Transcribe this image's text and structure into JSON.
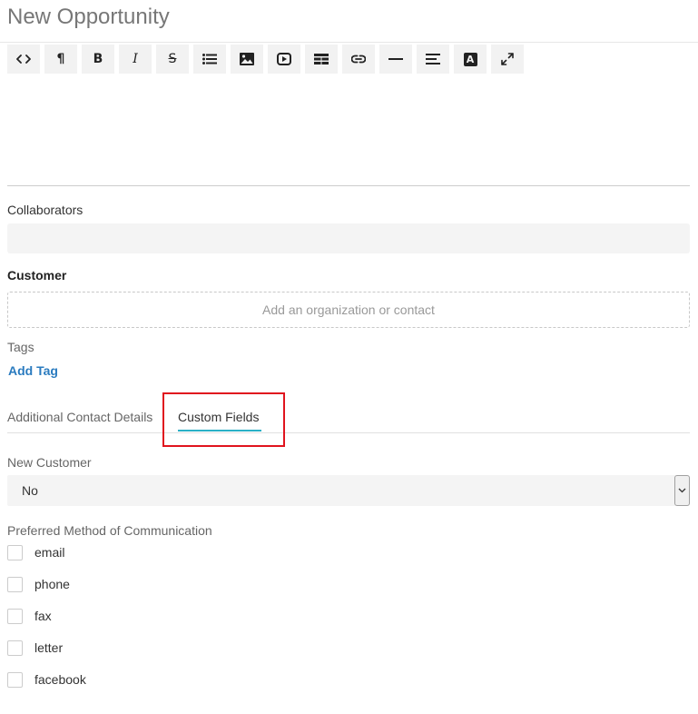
{
  "header": {
    "title": "New Opportunity"
  },
  "toolbar": {
    "buttons": [
      {
        "icon": "code-view-icon"
      },
      {
        "icon": "paragraph-icon",
        "glyph": "¶"
      },
      {
        "icon": "bold-icon",
        "glyph": "B"
      },
      {
        "icon": "italic-icon",
        "glyph": "I"
      },
      {
        "icon": "strikethrough-icon",
        "glyph": "S"
      },
      {
        "icon": "unordered-list-icon"
      },
      {
        "icon": "image-icon"
      },
      {
        "icon": "video-icon"
      },
      {
        "icon": "table-icon"
      },
      {
        "icon": "link-icon"
      },
      {
        "icon": "horizontal-rule-icon"
      },
      {
        "icon": "align-icon"
      },
      {
        "icon": "font-color-icon",
        "glyph": "A"
      },
      {
        "icon": "fullscreen-icon"
      }
    ]
  },
  "collaborators": {
    "label": "Collaborators",
    "value": ""
  },
  "customer": {
    "label": "Customer",
    "placeholder": "Add an organization or contact"
  },
  "tags": {
    "label": "Tags",
    "add_label": "Add Tag"
  },
  "tabs": [
    {
      "label": "Additional Contact Details",
      "active": false
    },
    {
      "label": "Custom Fields",
      "active": true
    }
  ],
  "custom_fields": {
    "new_customer": {
      "label": "New Customer",
      "selected": "No"
    },
    "communication": {
      "label": "Preferred Method of Communication",
      "options": [
        {
          "label": "email",
          "checked": false
        },
        {
          "label": "phone",
          "checked": false
        },
        {
          "label": "fax",
          "checked": false
        },
        {
          "label": "letter",
          "checked": false
        },
        {
          "label": "facebook",
          "checked": false
        }
      ]
    }
  },
  "colors": {
    "accent_tab": "#2ab0c6",
    "link": "#2a7bbf",
    "highlight": "#e0141e"
  }
}
